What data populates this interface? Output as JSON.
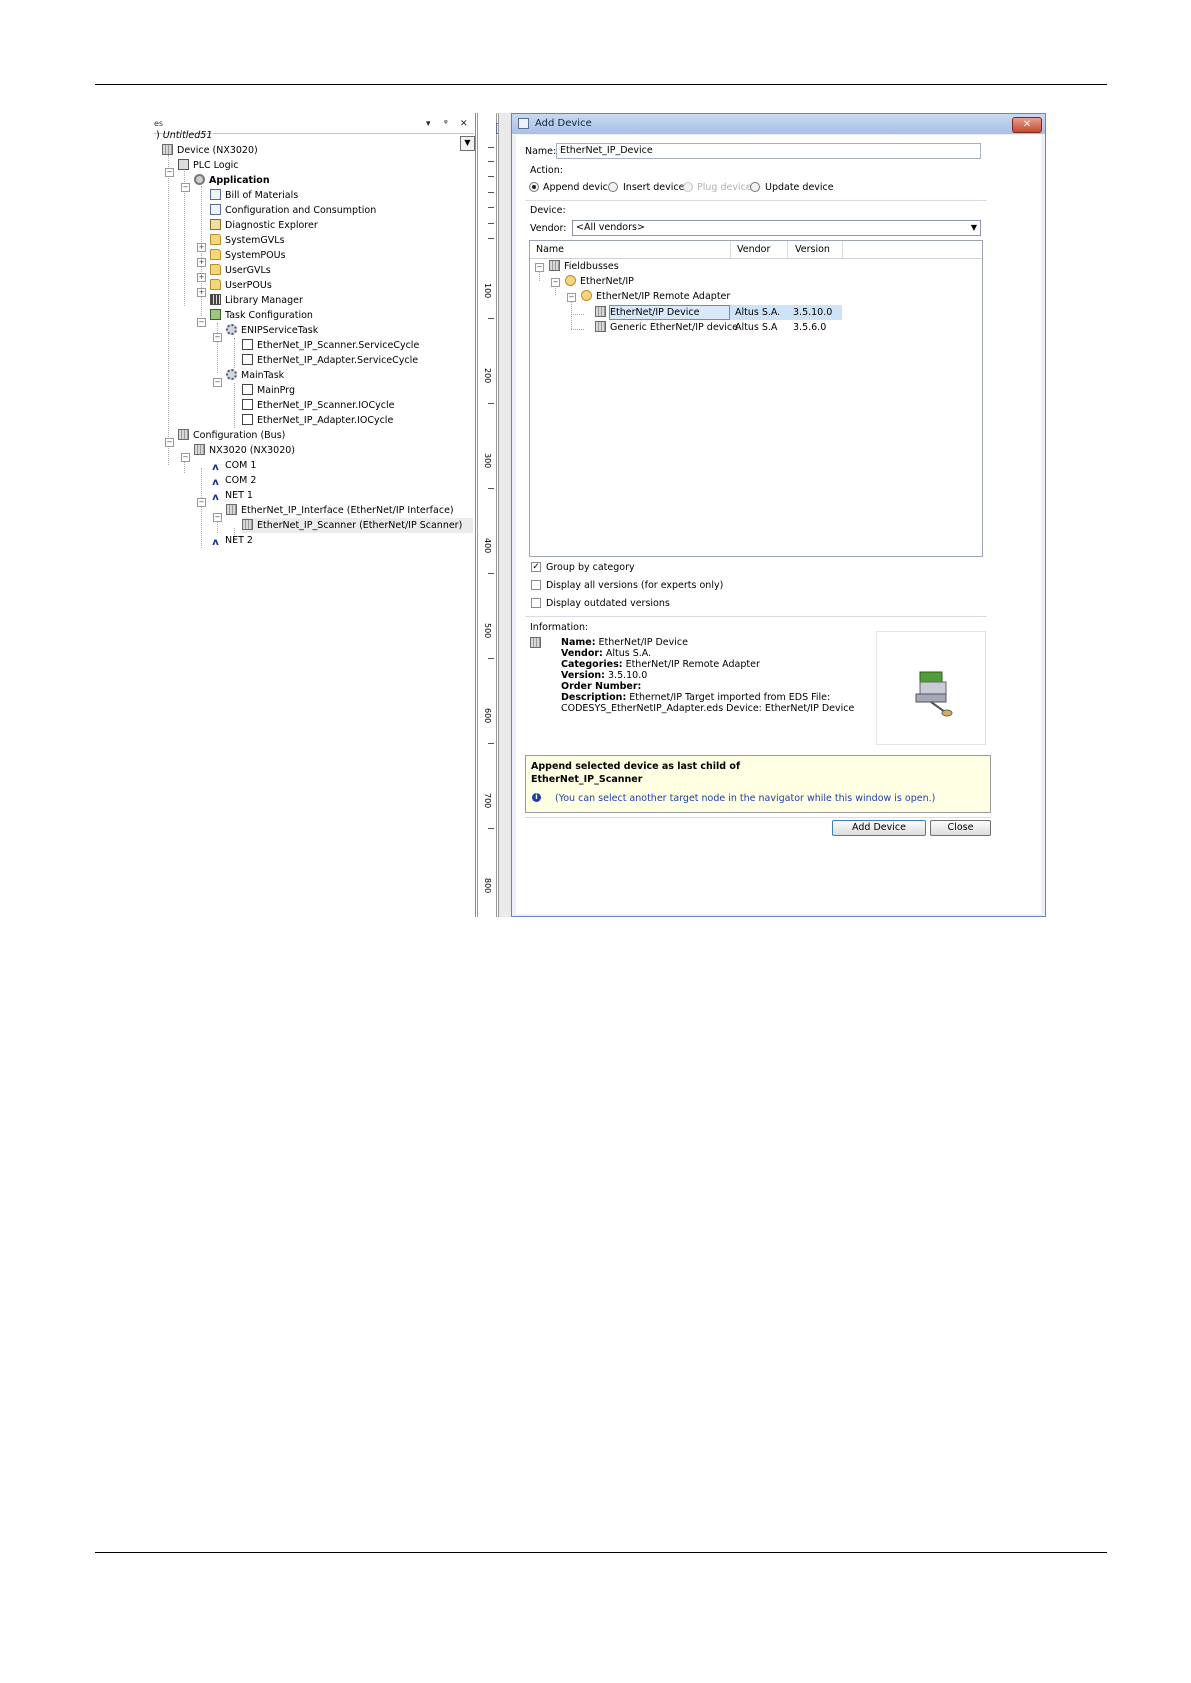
{
  "tree": {
    "header": "es",
    "project": "Untitled51",
    "items": [
      {
        "label": "Device (NX3020)",
        "icon": "device-icon"
      },
      {
        "label": "PLC Logic",
        "icon": "plc-icon"
      },
      {
        "label": "Application",
        "icon": "application-icon"
      },
      {
        "label": "Bill of Materials",
        "icon": "document-icon"
      },
      {
        "label": "Configuration and Consumption",
        "icon": "document-icon"
      },
      {
        "label": "Diagnostic Explorer",
        "icon": "diagnostic-icon"
      },
      {
        "label": "SystemGVLs",
        "icon": "folder-icon"
      },
      {
        "label": "SystemPOUs",
        "icon": "folder-icon"
      },
      {
        "label": "UserGVLs",
        "icon": "folder-icon"
      },
      {
        "label": "UserPOUs",
        "icon": "folder-icon"
      },
      {
        "label": "Library Manager",
        "icon": "library-icon"
      },
      {
        "label": "Task Configuration",
        "icon": "task-config-icon"
      },
      {
        "label": "ENIPServiceTask",
        "icon": "task-gear-icon"
      },
      {
        "label": "EtherNet_IP_Scanner.ServiceCycle",
        "icon": "pou-icon"
      },
      {
        "label": "EtherNet_IP_Adapter.ServiceCycle",
        "icon": "pou-icon"
      },
      {
        "label": "MainTask",
        "icon": "task-gear-icon"
      },
      {
        "label": "MainPrg",
        "icon": "pou-icon"
      },
      {
        "label": "EtherNet_IP_Scanner.IOCycle",
        "icon": "pou-icon"
      },
      {
        "label": "EtherNet_IP_Adapter.IOCycle",
        "icon": "pou-icon"
      },
      {
        "label": "Configuration (Bus)",
        "icon": "device-icon"
      },
      {
        "label": "NX3020 (NX3020)",
        "icon": "device-icon"
      },
      {
        "label": "COM 1",
        "icon": "port-icon"
      },
      {
        "label": "COM 2",
        "icon": "port-icon"
      },
      {
        "label": "NET 1",
        "icon": "port-icon"
      },
      {
        "label": "EtherNet_IP_Interface (EtherNet/IP Interface)",
        "icon": "device-icon"
      },
      {
        "label": "EtherNet_IP_Scanner (EtherNet/IP Scanner)",
        "icon": "device-icon"
      },
      {
        "label": "NET 2",
        "icon": "port-icon"
      }
    ]
  },
  "ruler": {
    "labels": [
      "100",
      "200",
      "300",
      "400",
      "500",
      "600",
      "700",
      "800"
    ]
  },
  "dialog": {
    "title": "Add Device",
    "close_label": "✕",
    "name_label": "Name:",
    "name_value": "EtherNet_IP_Device",
    "action_label": "Action:",
    "actions": [
      {
        "label": "Append device",
        "checked": true,
        "enabled": true
      },
      {
        "label": "Insert device",
        "checked": false,
        "enabled": true
      },
      {
        "label": "Plug device",
        "checked": false,
        "enabled": false
      },
      {
        "label": "Update device",
        "checked": false,
        "enabled": true
      }
    ],
    "device_label": "Device:",
    "vendor_label": "Vendor:",
    "vendor_value": "<All vendors>",
    "columns": [
      "Name",
      "Vendor",
      "Version"
    ],
    "device_tree": [
      {
        "name": "Fieldbusses",
        "vendor": "",
        "version": ""
      },
      {
        "name": "EtherNet/IP",
        "vendor": "",
        "version": ""
      },
      {
        "name": "EtherNet/IP Remote Adapter",
        "vendor": "",
        "version": ""
      },
      {
        "name": "EtherNet/IP Device",
        "vendor": "Altus S.A.",
        "version": "3.5.10.0"
      },
      {
        "name": "Generic EtherNet/IP device",
        "vendor": "Altus S.A",
        "version": "3.5.6.0"
      }
    ],
    "options": [
      {
        "label": "Group by category",
        "checked": true
      },
      {
        "label": "Display all versions (for experts only)",
        "checked": false
      },
      {
        "label": "Display outdated versions",
        "checked": false
      }
    ],
    "information_label": "Information:",
    "info": {
      "name_k": "Name:",
      "name_v": "EtherNet/IP Device",
      "vendor_k": "Vendor:",
      "vendor_v": "Altus S.A.",
      "categories_k": "Categories:",
      "categories_v": "EtherNet/IP Remote Adapter",
      "version_k": "Version:",
      "version_v": "3.5.10.0",
      "order_k": "Order Number:",
      "description_k": "Description:",
      "description_v": "Ethernet/IP Target imported from EDS File:",
      "description_line2": "CODESYS_EtherNetIP_Adapter.eds Device: EtherNet/IP Device"
    },
    "note_title": "Append selected device as last child of",
    "note_target": "EtherNet_IP_Scanner",
    "note_hint": "(You can select another target node in the navigator while this window is open.)",
    "add_button": "Add Device",
    "close_button": "Close",
    "colors": {
      "accent": "#3c7fb1",
      "selection": "#cfe3f8",
      "note_bg": "#ffffe3",
      "hint_text": "#1c3fae"
    }
  }
}
